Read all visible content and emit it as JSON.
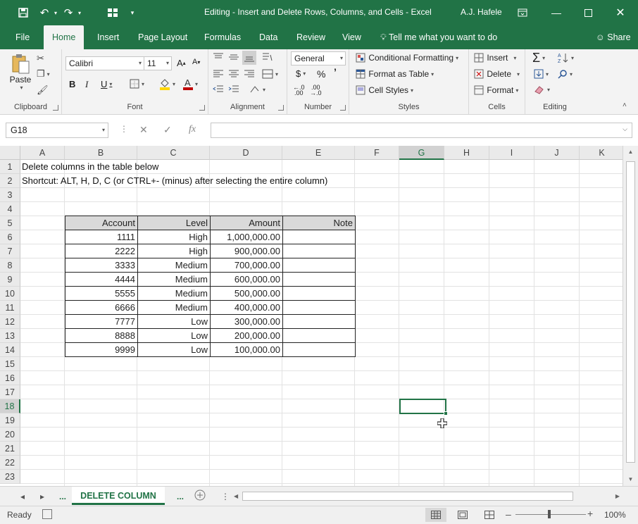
{
  "window": {
    "title": "Editing - Insert and Delete Rows, Columns, and Cells  -  Excel",
    "user": "A.J. Hafele"
  },
  "tabs": [
    "File",
    "Home",
    "Insert",
    "Page Layout",
    "Formulas",
    "Data",
    "Review",
    "View"
  ],
  "active_tab": "Home",
  "tell_me": "Tell me what you want to do",
  "share": "Share",
  "ribbon": {
    "clipboard": {
      "label": "Clipboard",
      "paste": "Paste"
    },
    "font": {
      "label": "Font",
      "name": "Calibri",
      "size": "11",
      "bold": "B",
      "italic": "I",
      "underline": "U"
    },
    "alignment": {
      "label": "Alignment"
    },
    "number": {
      "label": "Number",
      "format": "General"
    },
    "styles": {
      "label": "Styles",
      "conditional": "Conditional Formatting",
      "format_table": "Format as Table",
      "cell_styles": "Cell Styles"
    },
    "cells": {
      "label": "Cells",
      "insert": "Insert",
      "delete": "Delete",
      "format": "Format"
    },
    "editing": {
      "label": "Editing"
    }
  },
  "name_box": "G18",
  "formula": "",
  "columns": [
    "A",
    "B",
    "C",
    "D",
    "E",
    "F",
    "G",
    "H",
    "I",
    "J",
    "K"
  ],
  "selected_column": "G",
  "rows": [
    "1",
    "2",
    "3",
    "4",
    "5",
    "6",
    "7",
    "8",
    "9",
    "10",
    "11",
    "12",
    "13",
    "14",
    "15",
    "16",
    "17",
    "18",
    "19",
    "20",
    "21",
    "22",
    "23"
  ],
  "selected_row": "18",
  "sheet": {
    "a1": "Delete columns in the table below",
    "a2": "Shortcut: ALT, H, D, C (or CTRL+- (minus) after selecting the entire column)"
  },
  "table": {
    "headers": [
      "Account",
      "Level",
      "Amount",
      "Note"
    ],
    "rows": [
      [
        "1111",
        "High",
        "1,000,000.00",
        ""
      ],
      [
        "2222",
        "High",
        "900,000.00",
        ""
      ],
      [
        "3333",
        "Medium",
        "700,000.00",
        ""
      ],
      [
        "4444",
        "Medium",
        "600,000.00",
        ""
      ],
      [
        "5555",
        "Medium",
        "500,000.00",
        ""
      ],
      [
        "6666",
        "Medium",
        "400,000.00",
        ""
      ],
      [
        "7777",
        "Low",
        "300,000.00",
        ""
      ],
      [
        "8888",
        "Low",
        "200,000.00",
        ""
      ],
      [
        "9999",
        "Low",
        "100,000.00",
        ""
      ]
    ]
  },
  "sheet_tab": "DELETE COLUMN",
  "sheet_ellipsis": "...",
  "status": {
    "ready": "Ready",
    "zoom": "100%"
  },
  "colors": {
    "accent": "#217346",
    "header_fill": "#d9d9d9"
  }
}
